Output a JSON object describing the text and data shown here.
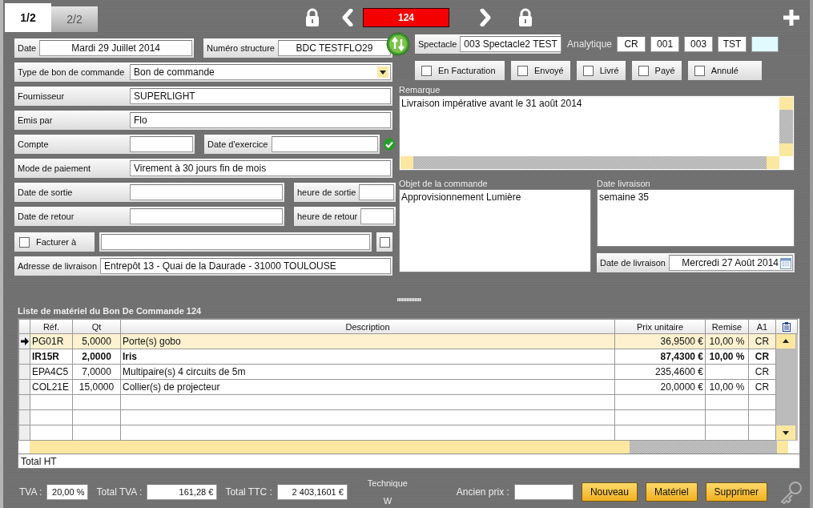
{
  "tabs": [
    {
      "label": "1/2",
      "selected": true
    },
    {
      "label": "2/2",
      "selected": false
    }
  ],
  "record": "124",
  "date": {
    "label": "Date",
    "value": "Mardi 29 Juillet 2014"
  },
  "structure": {
    "label": "Numéro structure",
    "value": "BDC TESTFLO29"
  },
  "order_type": {
    "label": "Type de bon de commande",
    "value": "Bon de commande"
  },
  "supplier": {
    "label": "Fournisseur",
    "value": "SUPERLIGHT"
  },
  "issued_by": {
    "label": "Emis par",
    "value": "Flo"
  },
  "account": {
    "label": "Compte"
  },
  "fiscal_date": {
    "label": "Date d'exercice"
  },
  "payment": {
    "label": "Mode de paiement",
    "value": "Virement à 30 jours fin de mois"
  },
  "exit": {
    "date_label": "Date de sortie",
    "time_label": "heure de sortie"
  },
  "return": {
    "date_label": "Date de retour",
    "time_label": "heure de retour"
  },
  "bill_to": {
    "label": "Facturer à",
    "checked": false,
    "option_checked": false
  },
  "delivery_address": {
    "label": "Adresse de livraison",
    "value": "Entrepôt 13 - Quai de la Daurade - 31000 TOULOUSE"
  },
  "show": {
    "label": "Spectacle",
    "value": "003 Spectacle2 TEST"
  },
  "analytics": {
    "label": "Analytique",
    "codes": [
      "CR",
      "001",
      "003",
      "TST"
    ]
  },
  "statuses": [
    {
      "label": "En Facturation",
      "checked": false
    },
    {
      "label": "Envoyé",
      "checked": false
    },
    {
      "label": "Livré",
      "checked": false
    },
    {
      "label": "Payé",
      "checked": false
    },
    {
      "label": "Annulé",
      "checked": false
    }
  ],
  "remark": {
    "label": "Remarque",
    "value": "Livraison impérative avant le 31 août 2014"
  },
  "subject": {
    "label": "Objet de la commande",
    "value": "Approvisionnement Lumière"
  },
  "delivery_note": {
    "label": "Date livraison",
    "value": "semaine 35"
  },
  "delivery_date": {
    "label": "Date de livraison",
    "value": "Mercredi 27 Août 2014"
  },
  "table": {
    "title": "Liste de matériel du Bon De Commande 124",
    "columns": [
      "Réf.",
      "Qt",
      "Description",
      "Prix unitaire",
      "Remise",
      "A1"
    ],
    "rows": [
      {
        "ref": "PG01R",
        "qty": "5,0000",
        "description": "Porte(s) gobo",
        "unit_price": "36,9500 €",
        "discount": "10,00 %",
        "a1": "CR",
        "selected": true,
        "bold": false
      },
      {
        "ref": "IR15R",
        "qty": "2,0000",
        "description": "Iris",
        "unit_price": "87,4300 €",
        "discount": "10,00 %",
        "a1": "CR",
        "selected": false,
        "bold": true
      },
      {
        "ref": "EPA4C5",
        "qty": "7,0000",
        "description": "Multipaire(s) 4 circuits de 5m",
        "unit_price": "235,4600 €",
        "a1": "CR",
        "selected": false,
        "bold": false
      },
      {
        "ref": "COL21E",
        "qty": "15,0000",
        "description": "Collier(s) de projecteur",
        "unit_price": "20,0000 €",
        "discount": "10,00 %",
        "a1": "CR",
        "selected": false,
        "bold": false
      }
    ],
    "total_label": "Total HT"
  },
  "vat": {
    "label": "TVA :",
    "value": "20,00 %"
  },
  "total_vat": {
    "label": "Total TVA :",
    "value": "161,28 €"
  },
  "total_ttc": {
    "label": "Total TTC :",
    "value": "2 403,1601 €"
  },
  "center_notes": [
    "Technique",
    "W"
  ],
  "old_price": {
    "label": "Ancien prix :"
  },
  "buttons": [
    "Nouveau",
    "Matériel",
    "Supprimer"
  ]
}
